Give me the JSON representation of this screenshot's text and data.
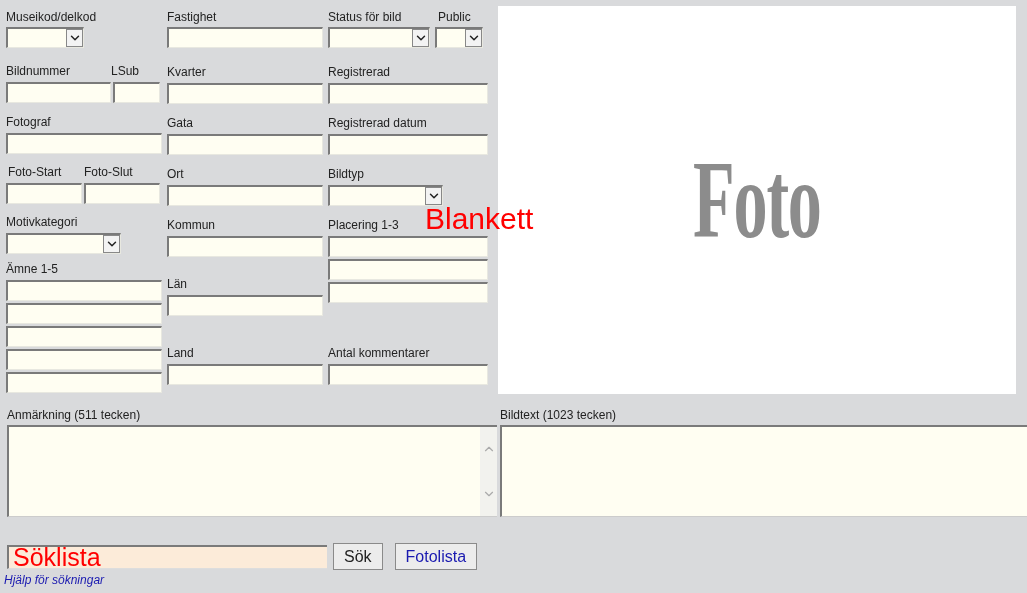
{
  "columns": [
    [
      {
        "labels": [
          "Museikod/delkod"
        ],
        "fields": [
          {
            "kind": "select"
          }
        ]
      },
      {
        "labels": [
          "Bildnummer",
          "LSub"
        ],
        "fields": [
          {
            "kind": "text"
          },
          {
            "kind": "text"
          }
        ]
      },
      {
        "labels": [
          "Fotograf"
        ],
        "fields": [
          {
            "kind": "text"
          }
        ]
      },
      {
        "labels": [
          "Foto-Start",
          "Foto-Slut"
        ],
        "fields": [
          {
            "kind": "text"
          },
          {
            "kind": "text"
          }
        ]
      },
      {
        "labels": [
          "Motivkategori"
        ],
        "fields": [
          {
            "kind": "select"
          }
        ]
      },
      {
        "labels": [
          "Ämne 1-5"
        ],
        "fields": [
          {
            "kind": "text"
          },
          {
            "kind": "text"
          },
          {
            "kind": "text"
          },
          {
            "kind": "text"
          },
          {
            "kind": "text"
          }
        ]
      }
    ],
    [
      {
        "labels": [
          "Fastighet"
        ],
        "fields": [
          {
            "kind": "text"
          }
        ]
      },
      {
        "labels": [
          "Kvarter"
        ],
        "fields": [
          {
            "kind": "text"
          }
        ]
      },
      {
        "labels": [
          "Gata"
        ],
        "fields": [
          {
            "kind": "text"
          }
        ]
      },
      {
        "labels": [
          "Ort"
        ],
        "fields": [
          {
            "kind": "text"
          }
        ]
      },
      {
        "labels": [
          "Kommun"
        ],
        "fields": [
          {
            "kind": "text"
          }
        ]
      },
      {
        "labels": [
          "Län"
        ],
        "fields": [
          {
            "kind": "text"
          }
        ]
      },
      {
        "labels": [
          "Land"
        ],
        "fields": [
          {
            "kind": "text"
          }
        ]
      }
    ],
    [
      {
        "labels": [
          "Status för bild",
          "Public"
        ],
        "fields": [
          {
            "kind": "select"
          },
          {
            "kind": "select"
          }
        ]
      },
      {
        "labels": [
          "Registrerad"
        ],
        "fields": [
          {
            "kind": "text"
          }
        ]
      },
      {
        "labels": [
          "Registrerad datum"
        ],
        "fields": [
          {
            "kind": "text"
          }
        ]
      },
      {
        "labels": [
          "Bildtyp"
        ],
        "fields": [
          {
            "kind": "select"
          }
        ]
      },
      {
        "labels": [
          "Placering 1-3"
        ],
        "fields": [
          {
            "kind": "text"
          },
          {
            "kind": "text"
          },
          {
            "kind": "text"
          }
        ]
      },
      {
        "labels": [
          "Antal kommentarer"
        ],
        "fields": [
          {
            "kind": "text"
          }
        ]
      }
    ]
  ],
  "photo": {
    "text": "Foto"
  },
  "overlay_label": "Blankett",
  "text_areas": [
    {
      "label": "Anmärkning (511 tecken)",
      "scrollbar": true
    },
    {
      "label": "Bildtext (1023 tecken)",
      "scrollbar": false
    }
  ],
  "search": {
    "value": "Söklista"
  },
  "buttons": [
    {
      "label": "Sök",
      "kind": "plain"
    },
    {
      "label": "Fotolista",
      "kind": "link"
    }
  ],
  "help_link": "Hjälp för sökningar"
}
